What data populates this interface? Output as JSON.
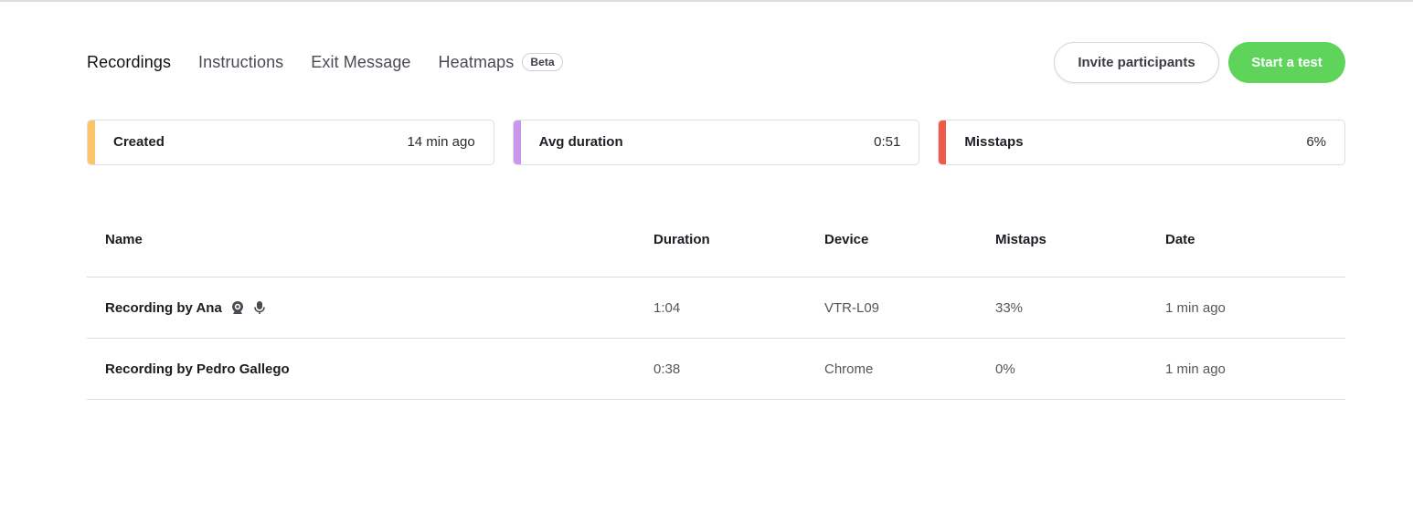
{
  "tabs": [
    {
      "label": "Recordings",
      "active": true
    },
    {
      "label": "Instructions",
      "active": false
    },
    {
      "label": "Exit Message",
      "active": false
    },
    {
      "label": "Heatmaps",
      "active": false,
      "badge": "Beta"
    }
  ],
  "actions": {
    "invite_label": "Invite participants",
    "start_label": "Start a test"
  },
  "stats": [
    {
      "label": "Created",
      "value": "14 min ago",
      "color": "#fcc56b"
    },
    {
      "label": "Avg duration",
      "value": "0:51",
      "color": "#c997ec"
    },
    {
      "label": "Misstaps",
      "value": "6%",
      "color": "#f05a4b"
    }
  ],
  "table": {
    "columns": [
      "Name",
      "Duration",
      "Device",
      "Mistaps",
      "Date"
    ],
    "rows": [
      {
        "name": "Recording by Ana",
        "duration": "1:04",
        "device": "VTR-L09",
        "mistaps": "33%",
        "date": "1 min ago",
        "icons": [
          "webcam-icon",
          "microphone-icon"
        ]
      },
      {
        "name": "Recording by Pedro Gallego",
        "duration": "0:38",
        "device": "Chrome",
        "mistaps": "0%",
        "date": "1 min ago",
        "icons": []
      }
    ]
  },
  "colors": {
    "accent_green": "#5fd45a",
    "border": "#dcdce0"
  }
}
